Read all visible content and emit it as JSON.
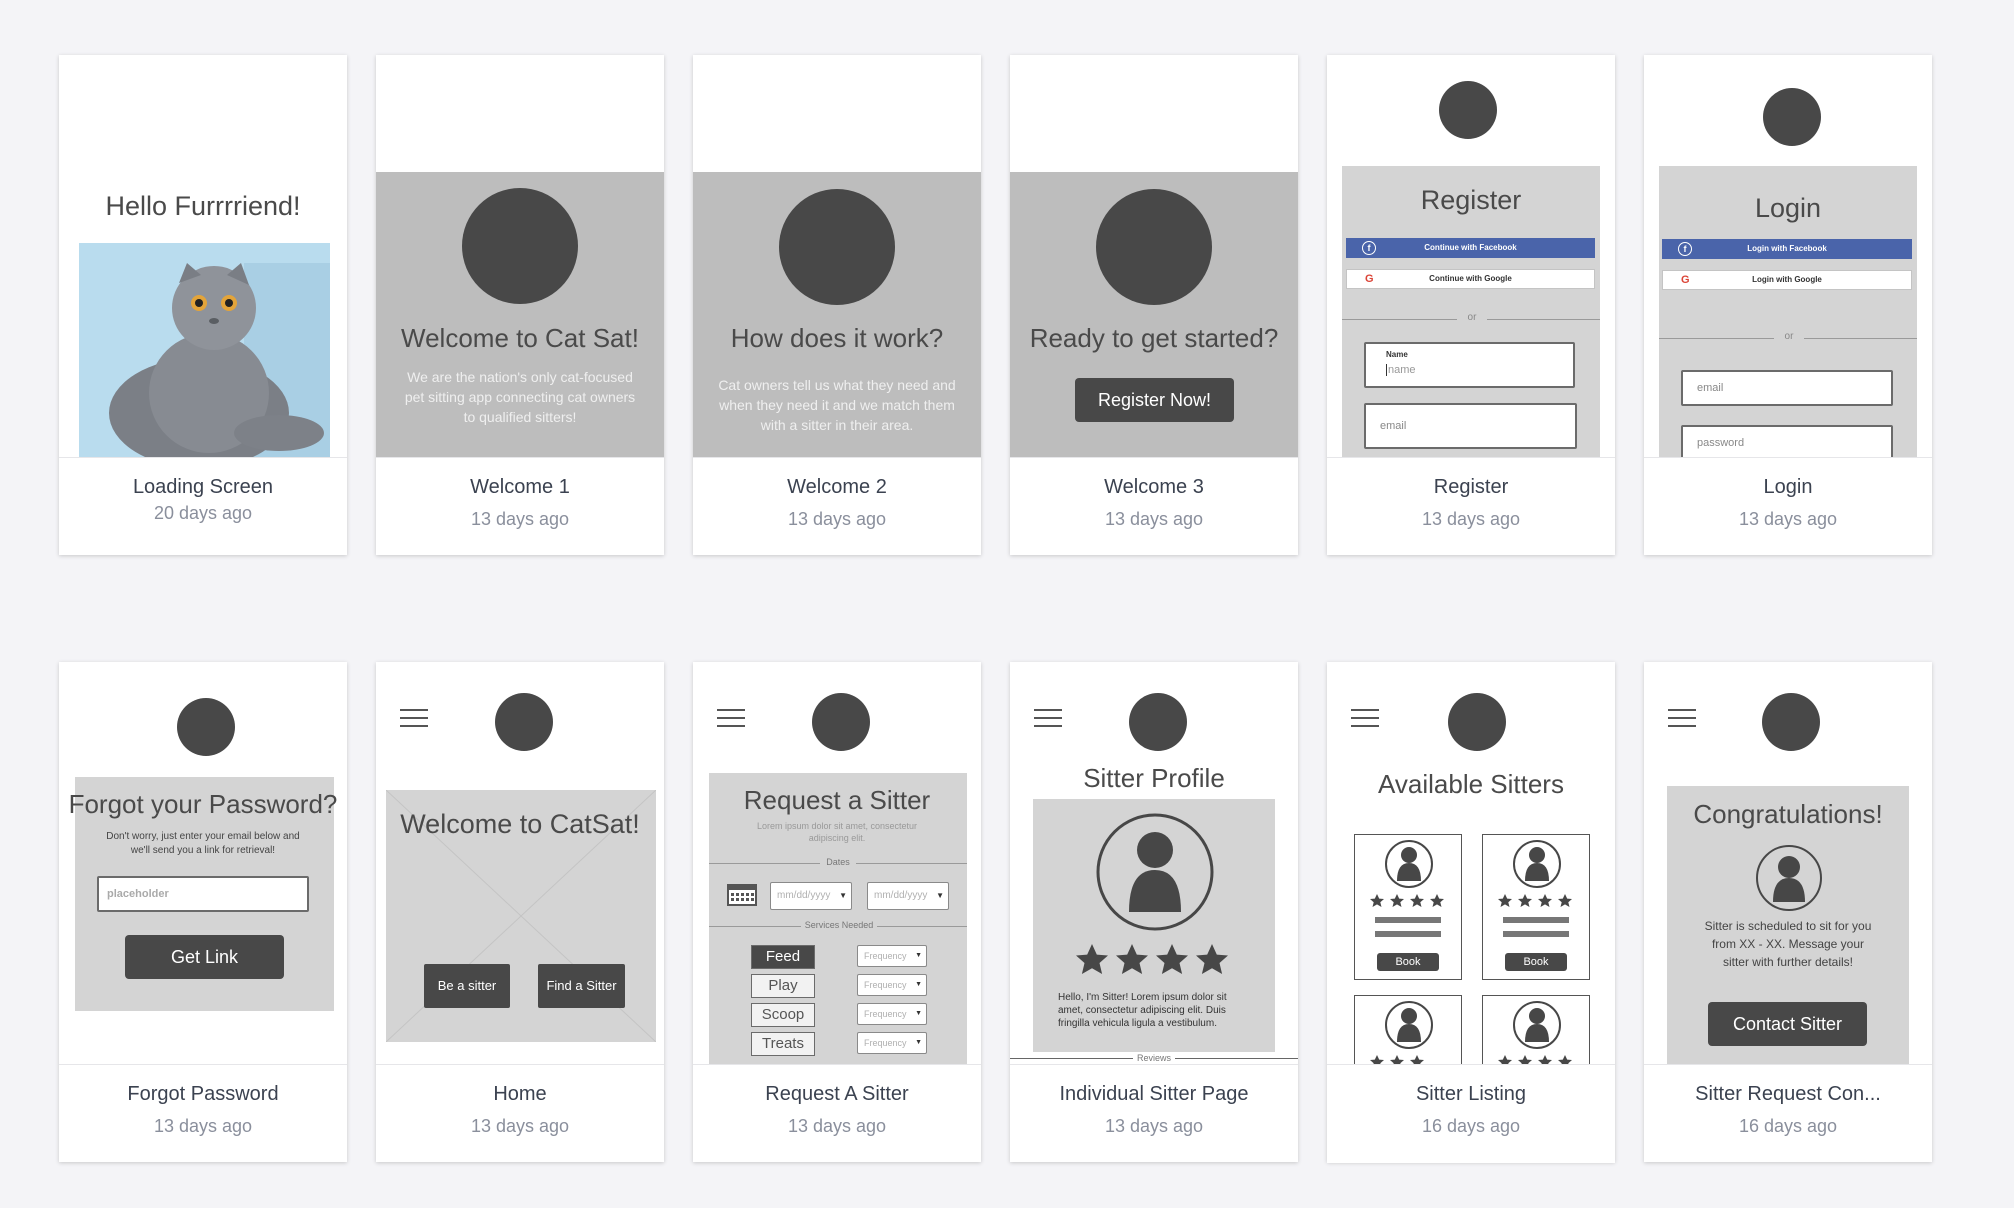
{
  "cards": [
    {
      "title": "Loading Screen",
      "date": "20 days ago"
    },
    {
      "title": "Welcome 1",
      "date": "13 days ago"
    },
    {
      "title": "Welcome 2",
      "date": "13 days ago"
    },
    {
      "title": "Welcome 3",
      "date": "13 days ago"
    },
    {
      "title": "Register",
      "date": "13 days ago"
    },
    {
      "title": "Login",
      "date": "13 days ago"
    },
    {
      "title": "Forgot Password",
      "date": "13 days ago"
    },
    {
      "title": "Home",
      "date": "13 days ago"
    },
    {
      "title": "Request A Sitter",
      "date": "13 days ago"
    },
    {
      "title": "Individual Sitter Page",
      "date": "13 days ago"
    },
    {
      "title": "Sitter Listing",
      "date": "16 days ago"
    },
    {
      "title": "Sitter Request Con...",
      "date": "16 days ago"
    }
  ],
  "loading": {
    "heading": "Hello Furrrriend!"
  },
  "welcome1": {
    "heading": "Welcome to Cat Sat!",
    "body": "We are the nation's only cat-focused pet sitting app connecting cat owners to qualified sitters!"
  },
  "welcome2": {
    "heading": "How does it work?",
    "body": "Cat owners tell us what they need and when they need it and we match them with a sitter in their area."
  },
  "welcome3": {
    "heading": "Ready to get started?",
    "button": "Register Now!"
  },
  "register": {
    "heading": "Register",
    "facebook": "Continue with Facebook",
    "google": "Continue with Google",
    "or": "or",
    "name_label": "Name",
    "name_value": "name",
    "email_placeholder": "email"
  },
  "login": {
    "heading": "Login",
    "facebook": "Login with Facebook",
    "google": "Login with Google",
    "or": "or",
    "email_placeholder": "email",
    "password_placeholder": "password"
  },
  "forgot": {
    "heading": "Forgot your Password?",
    "body": "Don't worry, just enter your email below and we'll send you a link for retrieval!",
    "input_placeholder": "placeholder",
    "button": "Get Link"
  },
  "home": {
    "heading": "Welcome to CatSat!",
    "btn_sitter": "Be a sitter",
    "btn_find": "Find a Sitter"
  },
  "request": {
    "heading": "Request a Sitter",
    "body": "Lorem ipsum dolor sit amet, consectetur adipiscing elit.",
    "dates_label": "Dates",
    "date_placeholder": "mm/dd/yyyy",
    "services_label": "Services Needed",
    "services": [
      "Feed",
      "Play",
      "Scoop",
      "Treats"
    ],
    "frequency": "Frequency"
  },
  "profile": {
    "heading": "Sitter Profile",
    "bio": "Hello, I'm Sitter! Lorem ipsum dolor sit amet, consectetur adipiscing elit. Duis fringilla vehicula ligula a vestibulum.",
    "reviews": "Reviews"
  },
  "listing": {
    "heading": "Available Sitters",
    "book": "Book"
  },
  "confirm": {
    "heading": "Congratulations!",
    "body": "Sitter is scheduled to sit for you from XX - XX. Message your sitter with further details!",
    "button": "Contact Sitter"
  },
  "colors": {
    "background": "#f4f4f7",
    "dark": "#484848",
    "panel": "#d4d4d4",
    "facebook": "#4a64aa"
  }
}
